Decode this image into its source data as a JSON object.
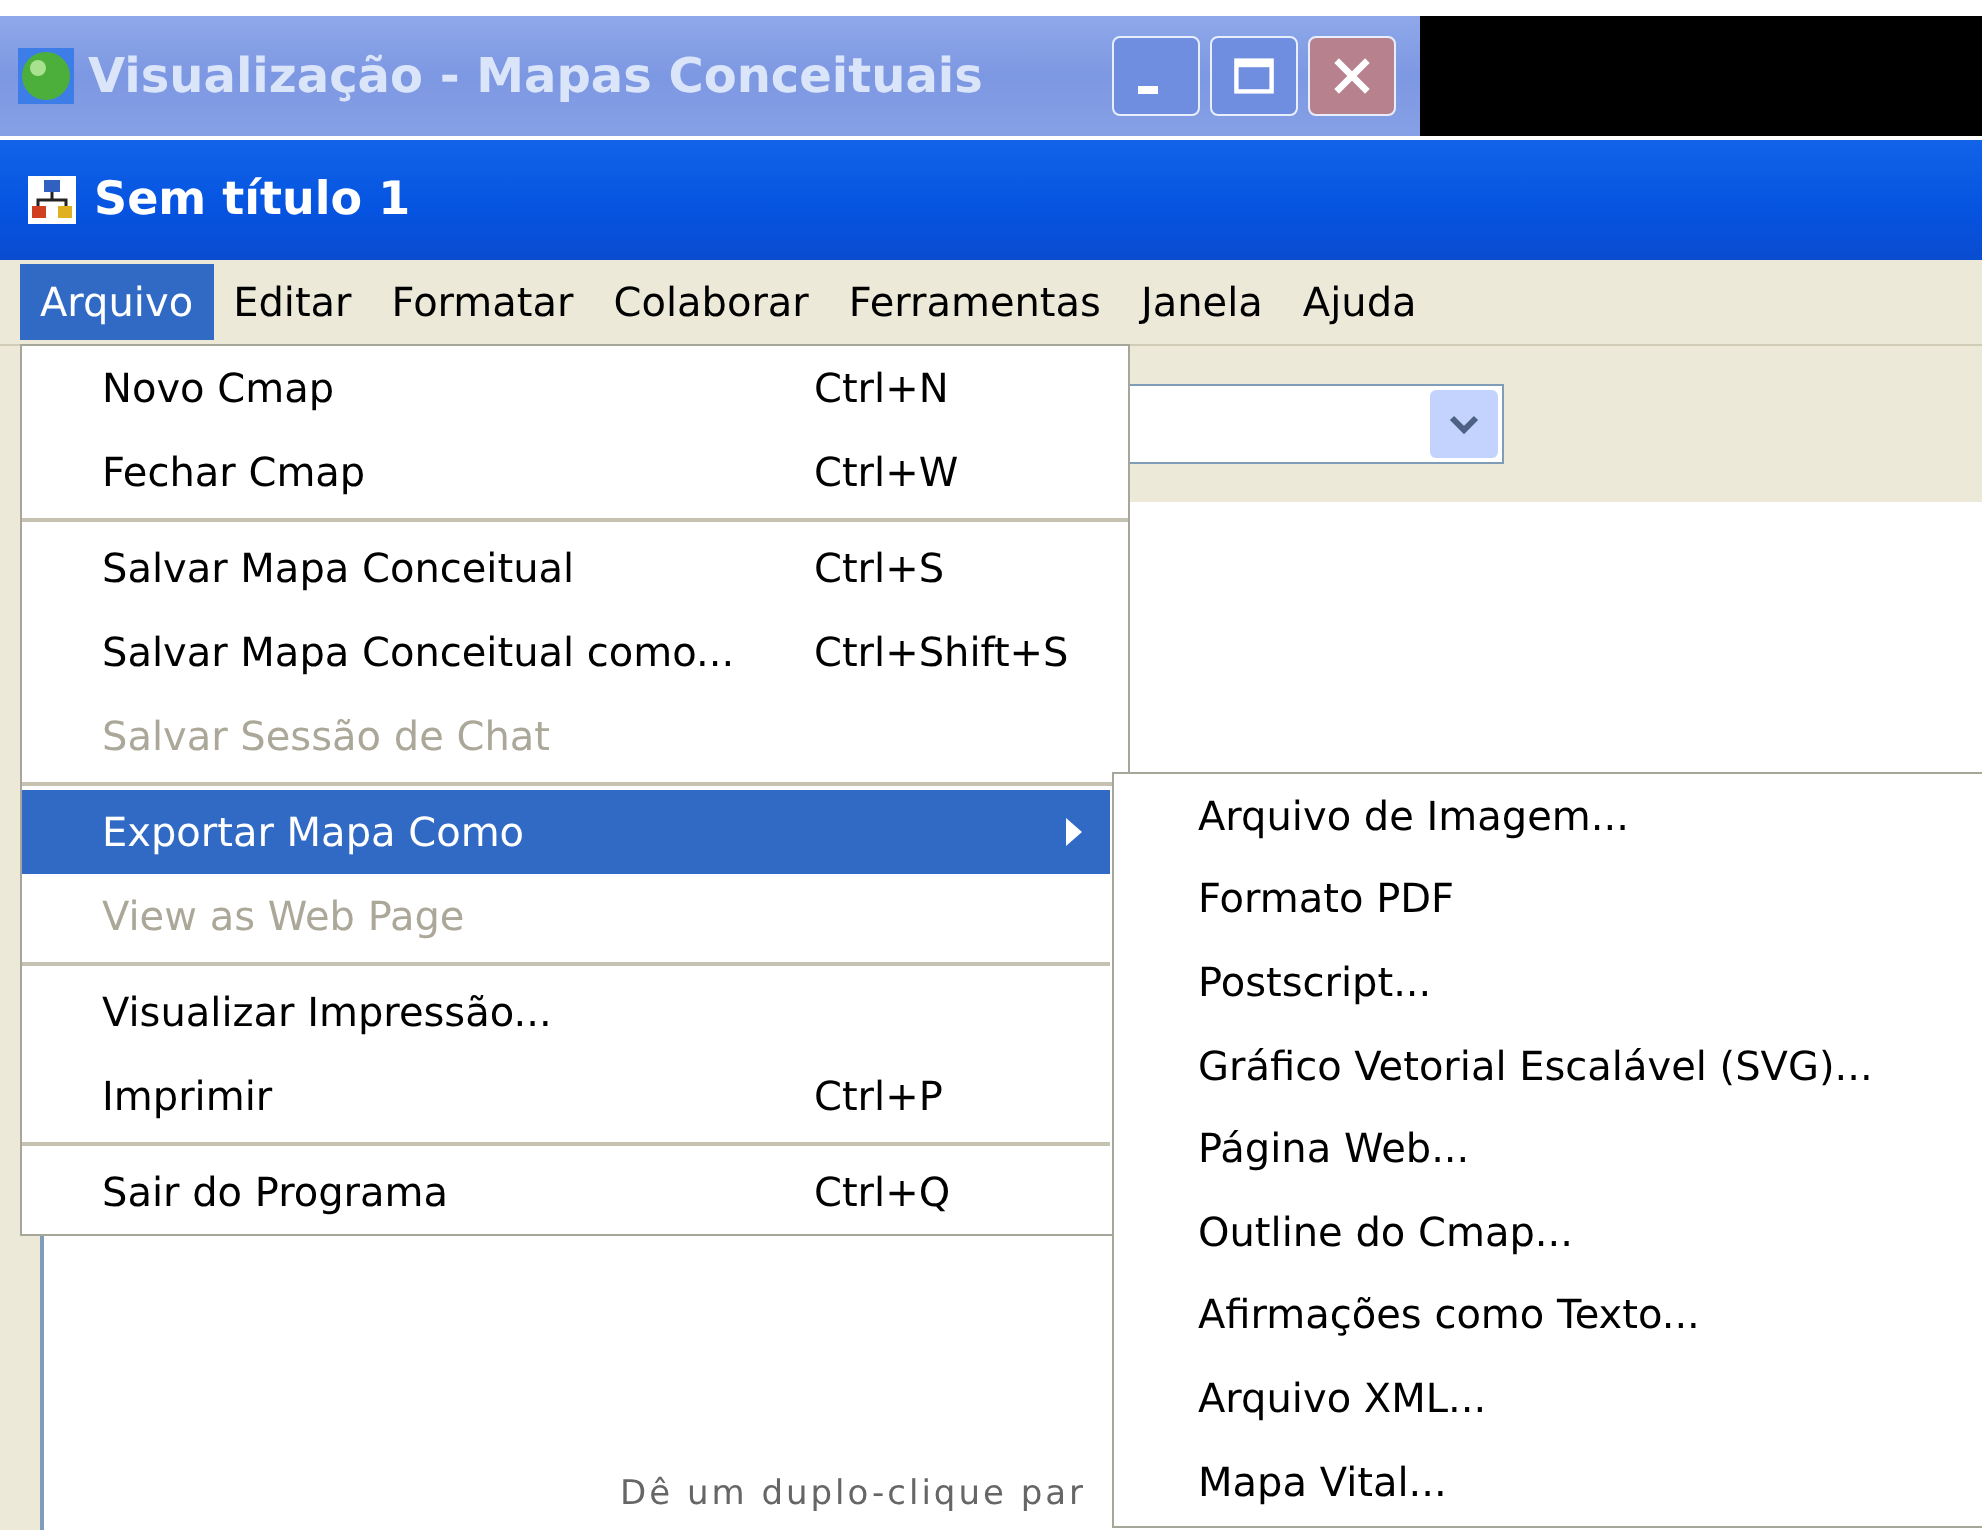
{
  "outer_window": {
    "title": "Visualização - Mapas Conceituais"
  },
  "document_window": {
    "title": "Sem título 1"
  },
  "menu_bar": [
    {
      "label": "Arquivo",
      "selected": true
    },
    {
      "label": "Editar",
      "selected": false
    },
    {
      "label": "Formatar",
      "selected": false
    },
    {
      "label": "Colaborar",
      "selected": false
    },
    {
      "label": "Ferramentas",
      "selected": false
    },
    {
      "label": "Janela",
      "selected": false
    },
    {
      "label": "Ajuda",
      "selected": false
    }
  ],
  "file_menu": [
    {
      "kind": "item",
      "label": "Novo Cmap",
      "shortcut": "Ctrl+N",
      "disabled": false,
      "selected": false
    },
    {
      "kind": "item",
      "label": "Fechar Cmap",
      "shortcut": "Ctrl+W",
      "disabled": false,
      "selected": false
    },
    {
      "kind": "separator"
    },
    {
      "kind": "item",
      "label": "Salvar Mapa Conceitual",
      "shortcut": "Ctrl+S",
      "disabled": false,
      "selected": false
    },
    {
      "kind": "item",
      "label": "Salvar Mapa Conceitual como...",
      "shortcut": "Ctrl+Shift+S",
      "disabled": false,
      "selected": false
    },
    {
      "kind": "item",
      "label": "Salvar Sessão de Chat",
      "disabled": true,
      "selected": false
    },
    {
      "kind": "separator"
    },
    {
      "kind": "submenu",
      "label": "Exportar Mapa Como",
      "disabled": false,
      "selected": true
    },
    {
      "kind": "item",
      "label": "View as Web Page",
      "disabled": true,
      "selected": false
    },
    {
      "kind": "separator"
    },
    {
      "kind": "item",
      "label": "Visualizar Impressão...",
      "disabled": false,
      "selected": false
    },
    {
      "kind": "item",
      "label": "Imprimir",
      "shortcut": "Ctrl+P",
      "disabled": false,
      "selected": false
    },
    {
      "kind": "separator"
    },
    {
      "kind": "item",
      "label": "Sair do Programa",
      "shortcut": "Ctrl+Q",
      "disabled": false,
      "selected": false
    }
  ],
  "export_submenu": [
    {
      "label": "Arquivo de Imagem..."
    },
    {
      "label": "Formato PDF"
    },
    {
      "label": "Postscript..."
    },
    {
      "label": "Gráfico Vetorial Escalável (SVG)..."
    },
    {
      "label": "Página Web..."
    },
    {
      "label": "Outline do Cmap..."
    },
    {
      "label": "Afirmações como Texto..."
    },
    {
      "label": "Arquivo XML..."
    },
    {
      "label": "Mapa Vital..."
    }
  ],
  "canvas": {
    "hint": "Dê um duplo-clique par"
  }
}
